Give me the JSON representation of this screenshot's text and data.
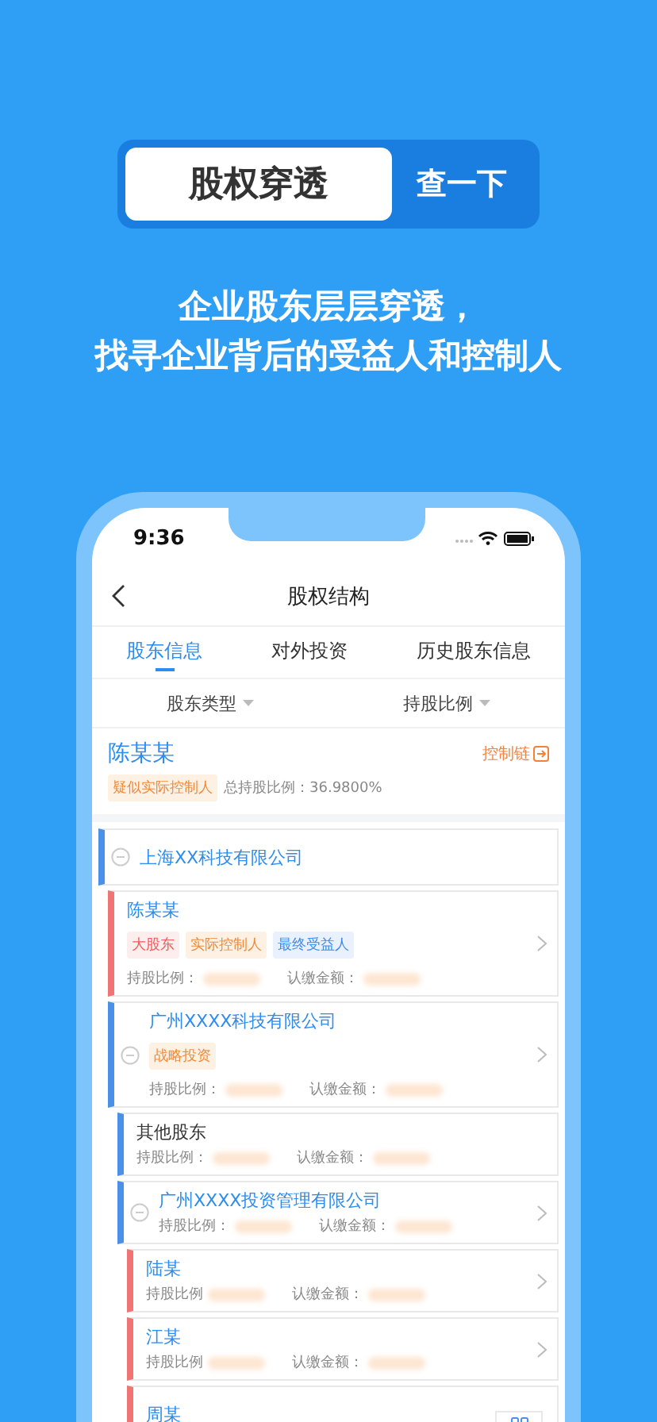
{
  "search": {
    "value": "股权穿透",
    "button": "查一下"
  },
  "headline": [
    "企业股东层层穿透，",
    "找寻企业背后的受益人和控制人"
  ],
  "phone": {
    "time": "9:36",
    "nav": {
      "title": "股权结构"
    },
    "tabs": [
      {
        "label": "股东信息",
        "selected": true
      },
      {
        "label": "对外投资",
        "selected": false
      },
      {
        "label": "历史股东信息",
        "selected": false
      }
    ],
    "filters": [
      "股东类型",
      "持股比例"
    ],
    "person": {
      "name": "陈某某",
      "link": "控制链",
      "tag": "疑似实际控制人",
      "ratio": "总持股比例：36.9800%"
    },
    "tree": [
      {
        "kind": "company",
        "name": "上海XX科技有限公司",
        "expanded": true,
        "children": [
          {
            "kind": "person",
            "name": "陈某某",
            "tags": [
              {
                "kind": "red",
                "label": "大股东"
              },
              {
                "kind": "orange",
                "label": "实际控制人"
              },
              {
                "kind": "blue",
                "label": "最终受益人"
              }
            ],
            "ratio_label": "持股比例：",
            "amount_label": "认缴金额：",
            "chevron": true
          },
          {
            "kind": "company",
            "name": "广州XXXX科技有限公司",
            "expanded": true,
            "tags": [
              {
                "kind": "orange",
                "label": "战略投资"
              }
            ],
            "ratio_label": "持股比例：",
            "amount_label": "认缴金额：",
            "chevron": true,
            "children": [
              {
                "kind": "other",
                "name": "其他股东",
                "ratio_label": "持股比例：",
                "amount_label": "认缴金额：",
                "chevron": false
              },
              {
                "kind": "company",
                "name": "广州XXXX投资管理有限公司",
                "expanded": true,
                "ratio_label": "持股比例：",
                "amount_label": "认缴金额：",
                "chevron": true,
                "children": [
                  {
                    "kind": "person",
                    "name": "陆某",
                    "ratio_label": "持股比例",
                    "amount_label": "认缴金额：",
                    "chevron": true
                  },
                  {
                    "kind": "person",
                    "name": "江某",
                    "ratio_label": "持股比例",
                    "amount_label": "认缴金额：",
                    "chevron": true
                  },
                  {
                    "kind": "person",
                    "name": "周某",
                    "chevron": false
                  }
                ]
              }
            ]
          }
        ]
      }
    ]
  }
}
